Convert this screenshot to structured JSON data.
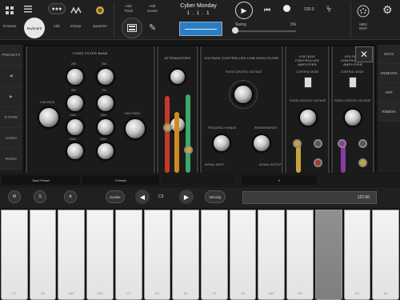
{
  "toolbar": {
    "browser": "browser",
    "keyboard": "keyboard",
    "edit": "edit",
    "transp": "transp.",
    "quantize": "quantize",
    "add_track": "Add\nTrack",
    "add_scene": "Add\nScene",
    "song_title": "Cyber Monday",
    "song_position": "1 . 1 . 1",
    "tempo": "120.0",
    "swing_label": "Swing",
    "swing_value": "0%",
    "midi_map": "MIDI\nMAP",
    "swing_level_percent": 0
  },
  "left_panel": [
    "PRESETS",
    "",
    "",
    "STORE",
    "UNDO",
    "REDO"
  ],
  "right_panel": [
    "KEYS",
    "ANIMOOG",
    "ARP",
    "RIBBON"
  ],
  "modules": {
    "filter_bank": {
      "title": "FIXED FILTER BANK",
      "low_pass": "LOW PASS",
      "high_pass": "HIGH PASS",
      "bands": [
        "250",
        "350",
        "500",
        "700",
        "1000",
        "1400",
        "2000",
        "2800"
      ]
    },
    "attenuators": {
      "title": "ATTENUATORS"
    },
    "vcf": {
      "title": "VOLTAGE CONTROLLED LOW PASS FILTER",
      "fixed_control": "FIXED CONTROL VOLTAGE",
      "frequency_range": "FREQUENCY RANGE",
      "regeneration": "REGENERATION",
      "signal_input": "SIGNAL INPUT",
      "signal_output": "SIGNAL OUTPUT"
    },
    "vca1": {
      "title": "VOLTAGE CONTROLLED AMPLIFIER",
      "control_mode": "CONTROL MODE",
      "fixed_gain": "FIXED CONTROL VOLTAGE"
    },
    "vca2": {
      "title": "VOLTAGE CONTROLLED AMPLIFIER",
      "control_mode": "CONTROL MODE",
      "fixed_gain": "FIXED CONTROL VOLTAGE"
    }
  },
  "preset_strip": {
    "save_preset": "Save Preset",
    "presets": "Presets",
    "close": "X"
  },
  "controls": {
    "m": "M",
    "s": "S",
    "a": "A",
    "scales": "Scales",
    "octave": "C3",
    "velocity": "Velocity",
    "velocity_value": "127.00"
  },
  "keyboard": {
    "keys": [
      "F2",
      "G2",
      "A#2",
      "A#2",
      "C3",
      "D3",
      "E3",
      "F3",
      "G3",
      "A#3",
      "B3",
      "C4",
      "D4",
      "E4"
    ],
    "pressed_index": 11
  }
}
